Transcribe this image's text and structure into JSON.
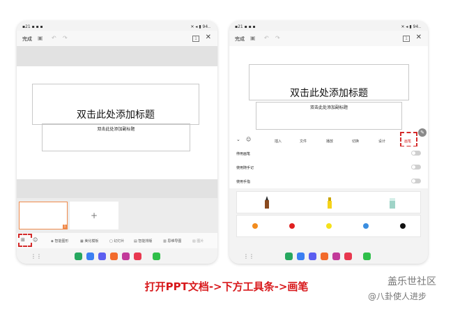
{
  "status_bar": {
    "time": "▪21 ▪ ▪ ▪",
    "icons": "✕ ◂ ▮ 94.."
  },
  "toolbar": {
    "done_label": "完成",
    "page_label": "1"
  },
  "slide": {
    "title": "双击此处添加标题",
    "subtitle": "双击此处添加副标题"
  },
  "thumbnails": {
    "add_label": "+",
    "slide_number": "1"
  },
  "bottom_toolbar": {
    "items": [
      "智能图形",
      "美化模板",
      "幻灯片",
      "智能排版",
      "思维导图",
      "图片"
    ]
  },
  "ribbon": {
    "tabs": [
      "插入",
      "文件",
      "播放",
      "切换",
      "设计",
      "画笔"
    ]
  },
  "pen_settings": {
    "rows": [
      "停用画笔",
      "使用随手记",
      "使用手指"
    ]
  },
  "pen_colors": [
    "#f28c1e",
    "#e02020",
    "#f5e11a",
    "#3b8ee0",
    "#111111"
  ],
  "caption": "打开PPT文档->下方工具条->画笔",
  "watermark": {
    "brand": "盖乐世社区",
    "author": "@八卦使人进步"
  }
}
